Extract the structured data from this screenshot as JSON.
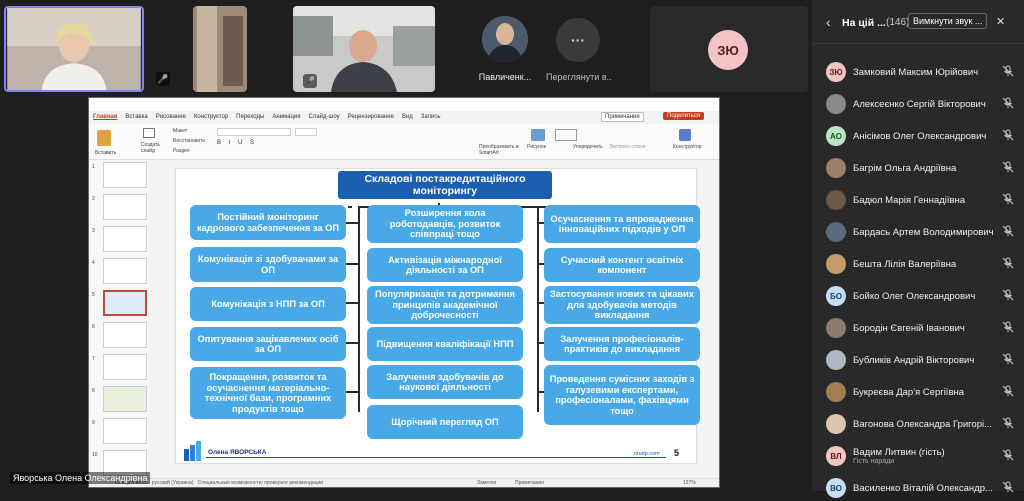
{
  "gallery": {
    "self_name": "Яворська Олена Олександрівна",
    "tile4_name": "Павличенк...",
    "tile5_name": "Переглянути в...",
    "tile6_initials": "ЗЮ",
    "more_glyph": "···"
  },
  "panel": {
    "back_glyph": "‹",
    "title": "На цій ...",
    "count": "(146)",
    "mute_all": "Вимкнути звук ...",
    "close_glyph": "✕",
    "participants": [
      {
        "name": "Замковий Максим Юрійович",
        "initials": "ЗЮ",
        "color": "#f4c4c4",
        "fg": "#5a1c1c",
        "photo": false
      },
      {
        "name": "Алексеєнко Сергій Вікторович",
        "initials": "",
        "color": "#8a8a8a",
        "fg": "#fff",
        "photo": true
      },
      {
        "name": "Анісімов Олег Олександрович",
        "initials": "АО",
        "color": "#bfe3c8",
        "fg": "#1d5a2a",
        "photo": false
      },
      {
        "name": "Багрім Ольга Андріївна",
        "initials": "",
        "color": "#9c7f6a",
        "fg": "#fff",
        "photo": true
      },
      {
        "name": "Бадюл Марія Геннадіївна",
        "initials": "",
        "color": "#6c5a4a",
        "fg": "#fff",
        "photo": true
      },
      {
        "name": "Бардась Артем Володимирович",
        "initials": "",
        "color": "#5a6a7a",
        "fg": "#fff",
        "photo": true
      },
      {
        "name": "Бешта Лілія Валеріївна",
        "initials": "",
        "color": "#c59a6a",
        "fg": "#fff",
        "photo": true
      },
      {
        "name": "Бойко Олег Олександрович",
        "initials": "БО",
        "color": "#c9def5",
        "fg": "#1d3f6a",
        "photo": false
      },
      {
        "name": "Бородін Євгеній Іванович",
        "initials": "",
        "color": "#8a7a70",
        "fg": "#fff",
        "photo": true
      },
      {
        "name": "Бубликів Андрій Вікторович",
        "initials": "",
        "color": "#b0b8c4",
        "fg": "#fff",
        "photo": true
      },
      {
        "name": "Букреєва Дар'я Сергіївна",
        "initials": "",
        "color": "#a08050",
        "fg": "#fff",
        "photo": true
      },
      {
        "name": "Вагонова Олександра Григорі...",
        "initials": "",
        "color": "#d8c4b0",
        "fg": "#fff",
        "photo": true
      },
      {
        "name": "Вадим Литвин (гість)",
        "sub": "Гість наради",
        "initials": "ВЛ",
        "color": "#f4c4c4",
        "fg": "#5a1c1c",
        "photo": false
      },
      {
        "name": "Василенко Віталій Олександр...",
        "initials": "ВО",
        "color": "#c9def5",
        "fg": "#1d3f6a",
        "photo": false
      }
    ]
  },
  "powerpoint": {
    "tabs": [
      "Главная",
      "Вставка",
      "Рисование",
      "Конструктор",
      "Переходы",
      "Анимация",
      "Слайд-шоу",
      "Рецензирование",
      "Вид",
      "Запись"
    ],
    "comments": "Примечания",
    "share": "Поделиться",
    "ribbon": {
      "paste": "Вставить",
      "new_slide": "Создать слайд",
      "layout": "Макет",
      "reset": "Восстановить",
      "section": "Раздел",
      "convert": "Преобразовать в SmartArt",
      "picture": "Рисунок",
      "arrange": "Упорядочить",
      "quick_styles": "Экспресс-стили",
      "designer": "Конструктор"
    },
    "thumb_numbers": [
      "1",
      "2",
      "3",
      "4",
      "5",
      "6",
      "7",
      "8",
      "9",
      "10"
    ],
    "status_left": "Слайд 5 из 25",
    "status_lang": "русский (Украина)",
    "status_access": "Специальные возможности: проверьте рекомендации",
    "status_notes": "Заметки",
    "status_comments": "Примечания",
    "status_zoom": "127%"
  },
  "slide": {
    "title": "Складові постакредитаційного моніторингу",
    "left": [
      "Постійний моніторинг кадрового забезпечення за ОП",
      "Комунікація зі здобувачами за ОП",
      "Комунікація з НПП за ОП",
      "Опитування зацікавлених осіб за ОП",
      "Покращення, розвиток та осучаснення матеріально-технічної бази, програмних продуктів тощо"
    ],
    "middle": [
      "Розширення кола роботодавців, розвиток співпраці тощо",
      "Активізація міжнародної діяльності за ОП",
      "Популяризація та дотримання принципів академічної доброчесності",
      "Підвищення кваліфікації НПП",
      "Залучення здобувачів до наукової діяльності",
      "Щорічний перегляд ОП"
    ],
    "right": [
      "Осучаснення та впровадження інноваційних підходів у ОП",
      "Сучасний контент освітніх компонент",
      "Застосування нових та цікавих для здобувачів методів викладання",
      "Залучення професіоналів-практиків до викладання",
      "Проведення сумісних заходів з галузевими експертами, професіоналами, фахівцями тощо"
    ],
    "author": "Олена ЯВОРСЬКА",
    "site": "ntudp.com",
    "page": "5"
  }
}
